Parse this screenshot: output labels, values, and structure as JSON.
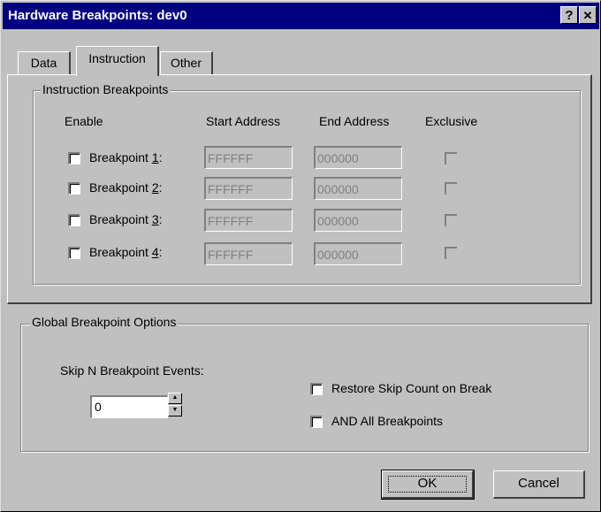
{
  "window": {
    "title": "Hardware Breakpoints: dev0",
    "help_label": "?",
    "close_label": "✕"
  },
  "tabs": [
    {
      "label": "Data"
    },
    {
      "label": "Instruction",
      "active": true
    },
    {
      "label": "Other"
    }
  ],
  "instruction_group": {
    "title": "Instruction Breakpoints",
    "headers": {
      "enable": "Enable",
      "start": "Start Address",
      "end": "End Address",
      "exclusive": "Exclusive"
    },
    "rows": [
      {
        "label_prefix": "Breakpoint ",
        "label_key": "1",
        "label_suffix": ":",
        "start": "FFFFFF",
        "end": "000000"
      },
      {
        "label_prefix": "Breakpoint ",
        "label_key": "2",
        "label_suffix": ":",
        "start": "FFFFFF",
        "end": "000000"
      },
      {
        "label_prefix": "Breakpoint ",
        "label_key": "3",
        "label_suffix": ":",
        "start": "FFFFFF",
        "end": "000000"
      },
      {
        "label_prefix": "Breakpoint ",
        "label_key": "4",
        "label_suffix": ":",
        "start": "FFFFFF",
        "end": "000000"
      }
    ]
  },
  "global_group": {
    "title": "Global Breakpoint Options",
    "skip_label": "Skip N Breakpoint Events:",
    "skip_value": "0",
    "restore_label": "Restore Skip Count on Break",
    "and_label": "AND All Breakpoints"
  },
  "buttons": {
    "ok_label": "OK",
    "cancel_label": "Cancel"
  },
  "colors": {
    "titlebar": "#000080",
    "face": "#c0c0c0"
  }
}
